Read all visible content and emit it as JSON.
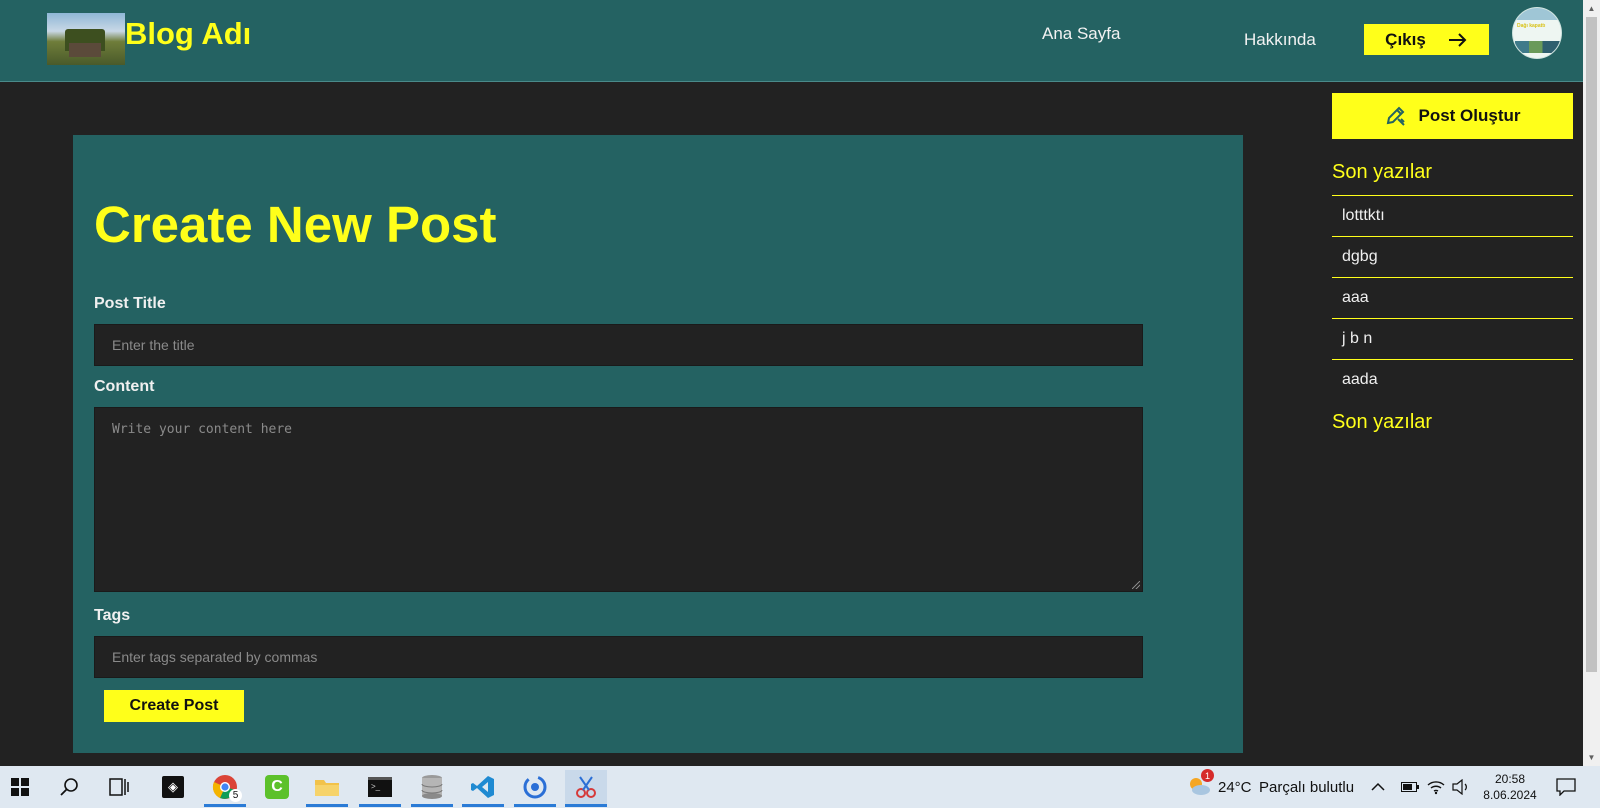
{
  "header": {
    "blog_title": "Blog Adı",
    "nav": {
      "home": "Ana Sayfa",
      "about": "Hakkında"
    },
    "logout_label": "Çıkış",
    "avatar_text": "Dağı kapattı"
  },
  "form": {
    "heading": "Create New Post",
    "title_label": "Post Title",
    "title_placeholder": "Enter the title",
    "content_label": "Content",
    "content_placeholder": "Write your content here",
    "tags_label": "Tags",
    "tags_placeholder": "Enter tags separated by commas",
    "submit_label": "Create Post"
  },
  "sidebar": {
    "create_label": "Post Oluştur",
    "recent_heading": "Son yazılar",
    "recent_heading_2": "Son yazılar",
    "recent_posts": [
      "lotttktı",
      "dgbg",
      "aaa",
      "j b n",
      "aada"
    ]
  },
  "taskbar": {
    "weather_temp": "24°C",
    "weather_desc": "Parçalı bulutlu",
    "weather_badge": "1",
    "time": "20:58",
    "date": "8.06.2024",
    "chrome_badge": "5"
  },
  "colors": {
    "accent": "#ffff1a",
    "teal": "#246262",
    "dark": "#222222"
  }
}
